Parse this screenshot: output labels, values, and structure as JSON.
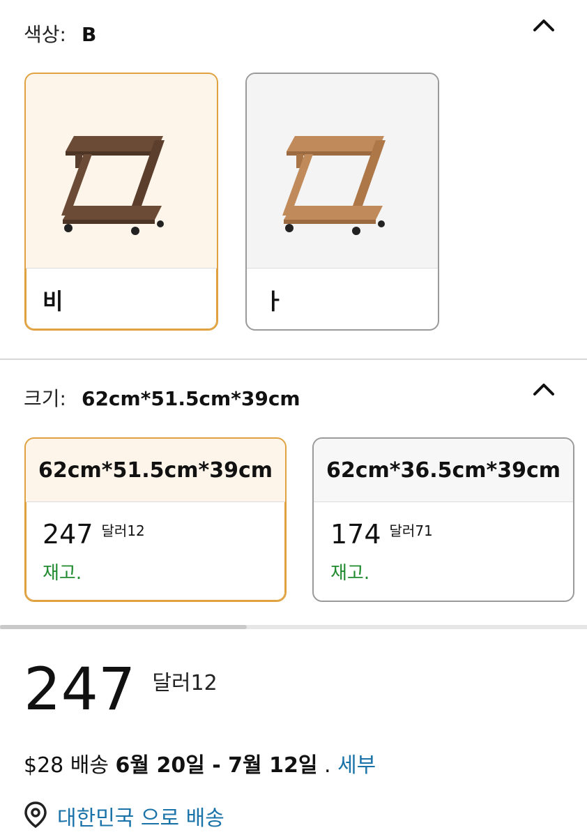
{
  "color_section": {
    "label": "색상:",
    "selected_value": "B",
    "collapse_icon": "chevron-up-icon",
    "options": [
      {
        "label": "비",
        "selected": true,
        "wood_tone": "#6b4a36"
      },
      {
        "label": "ㅏ",
        "selected": false,
        "wood_tone": "#b27a4c"
      }
    ]
  },
  "size_section": {
    "label": "크기:",
    "selected_value": "62cm*51.5cm*39cm",
    "collapse_icon": "chevron-up-icon",
    "options": [
      {
        "name": "62cm*51.5cm*39cm",
        "price_whole": "247",
        "price_fraction": "달러12",
        "stock": "재고.",
        "selected": true
      },
      {
        "name": "62cm*36.5cm*39cm",
        "price_whole": "174",
        "price_fraction": "달러71",
        "stock": "재고.",
        "selected": false
      }
    ],
    "scroll_position": 0.42
  },
  "price": {
    "whole": "247",
    "fraction": "달러12"
  },
  "delivery": {
    "fee": "$28 배송",
    "dates": "6월 20일 - 7월 12일",
    "separator": ".",
    "details_link": "세부"
  },
  "ship_to": {
    "icon": "location-pin-icon",
    "text": "대한민국 으로 배송"
  },
  "colors": {
    "selected_border": "#e0a240",
    "selected_bg": "#fdf4ea",
    "in_stock": "#1f8a2e",
    "link": "#1a73a8"
  }
}
